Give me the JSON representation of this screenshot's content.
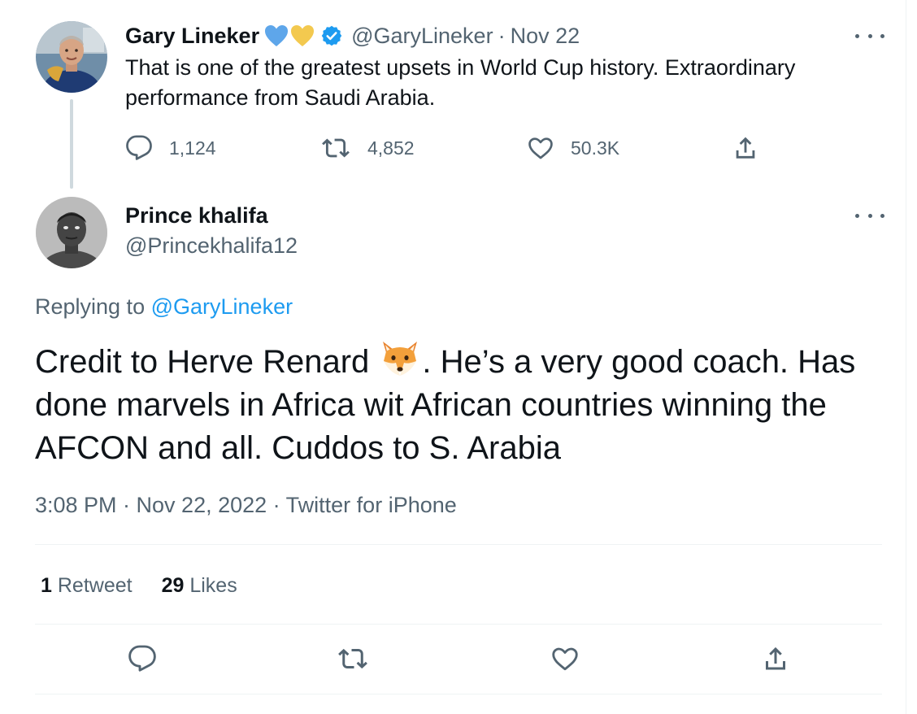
{
  "parent_tweet": {
    "author_name": "Gary Lineker",
    "emoji": [
      "blue-heart",
      "yellow-heart"
    ],
    "verified": true,
    "handle": "@GaryLineker",
    "separator": "·",
    "date": "Nov 22",
    "text": "That is one of the greatest upsets in World Cup history. Extraordinary performance from Saudi Arabia.",
    "actions": {
      "reply_count": "1,124",
      "retweet_count": "4,852",
      "like_count": "50.3K"
    }
  },
  "reply_tweet": {
    "author_name": "Prince khalifa",
    "handle": "@Princekhalifa12",
    "replying_prefix": "Replying to",
    "replying_to": "@GaryLineker",
    "text_before_emoji": "Credit to Herve Renard",
    "emoji": "fox-face",
    "text_after_emoji": ". He’s a very good coach. Has done marvels in Africa wit African countries winning the AFCON and all. Cuddos to S. Arabia",
    "meta": "3:08 PM · Nov 22, 2022 · Twitter for iPhone",
    "stats": {
      "retweets_count": "1",
      "retweets_label": "Retweet",
      "likes_count": "29",
      "likes_label": "Likes"
    }
  },
  "colors": {
    "text": "#0f1419",
    "secondary": "#536471",
    "accent": "#1d9bf0",
    "divider": "#eff3f4",
    "thread_line": "#cfd9de"
  },
  "icons": [
    "reply-icon",
    "retweet-icon",
    "like-icon",
    "share-icon",
    "more-icon",
    "verified-badge-icon"
  ]
}
